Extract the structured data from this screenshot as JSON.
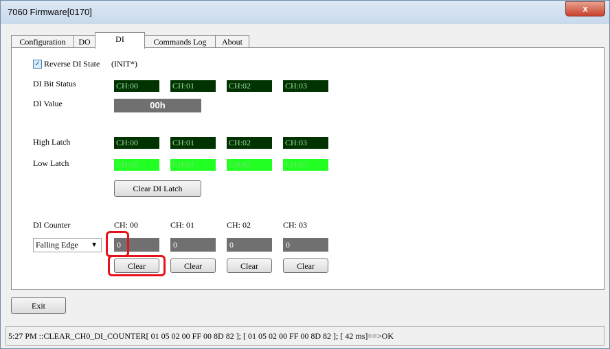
{
  "window": {
    "title": "7060 Firmware[0170]",
    "close_glyph": "x"
  },
  "tabs": [
    {
      "label": "Configuration"
    },
    {
      "label": "DO"
    },
    {
      "label": "DI"
    },
    {
      "label": "Commands Log"
    },
    {
      "label": "About"
    }
  ],
  "di": {
    "reverse_label": "Reverse DI State",
    "reverse_note": "(INIT*)",
    "reverse_checked": true,
    "bit_status_label": "DI Bit Status",
    "value_label": "DI Value",
    "value": "00h",
    "high_latch_label": "High Latch",
    "low_latch_label": "Low Latch",
    "channels": [
      "CH:00",
      "CH:01",
      "CH:02",
      "CH:03"
    ],
    "clear_latch_label": "Clear DI Latch",
    "counter_label": "DI Counter",
    "counter_channels": [
      "CH: 00",
      "CH: 01",
      "CH: 02",
      "CH: 03"
    ],
    "edge_selected": "Falling Edge",
    "counter_values": [
      "0",
      "0",
      "0",
      "0"
    ],
    "clear_label": "Clear"
  },
  "exit_label": "Exit",
  "status_text": "5:27 PM ::CLEAR_CH0_DI_COUNTER[ 01 05 02 00 FF 00 8D 82 ]; [ 01 05 02 00 FF 00 8D 82  ]; [ 42 ms]==>OK",
  "colors": {
    "led_on": "#22ff22",
    "led_off": "#003300",
    "highlight": "#e8101a"
  }
}
